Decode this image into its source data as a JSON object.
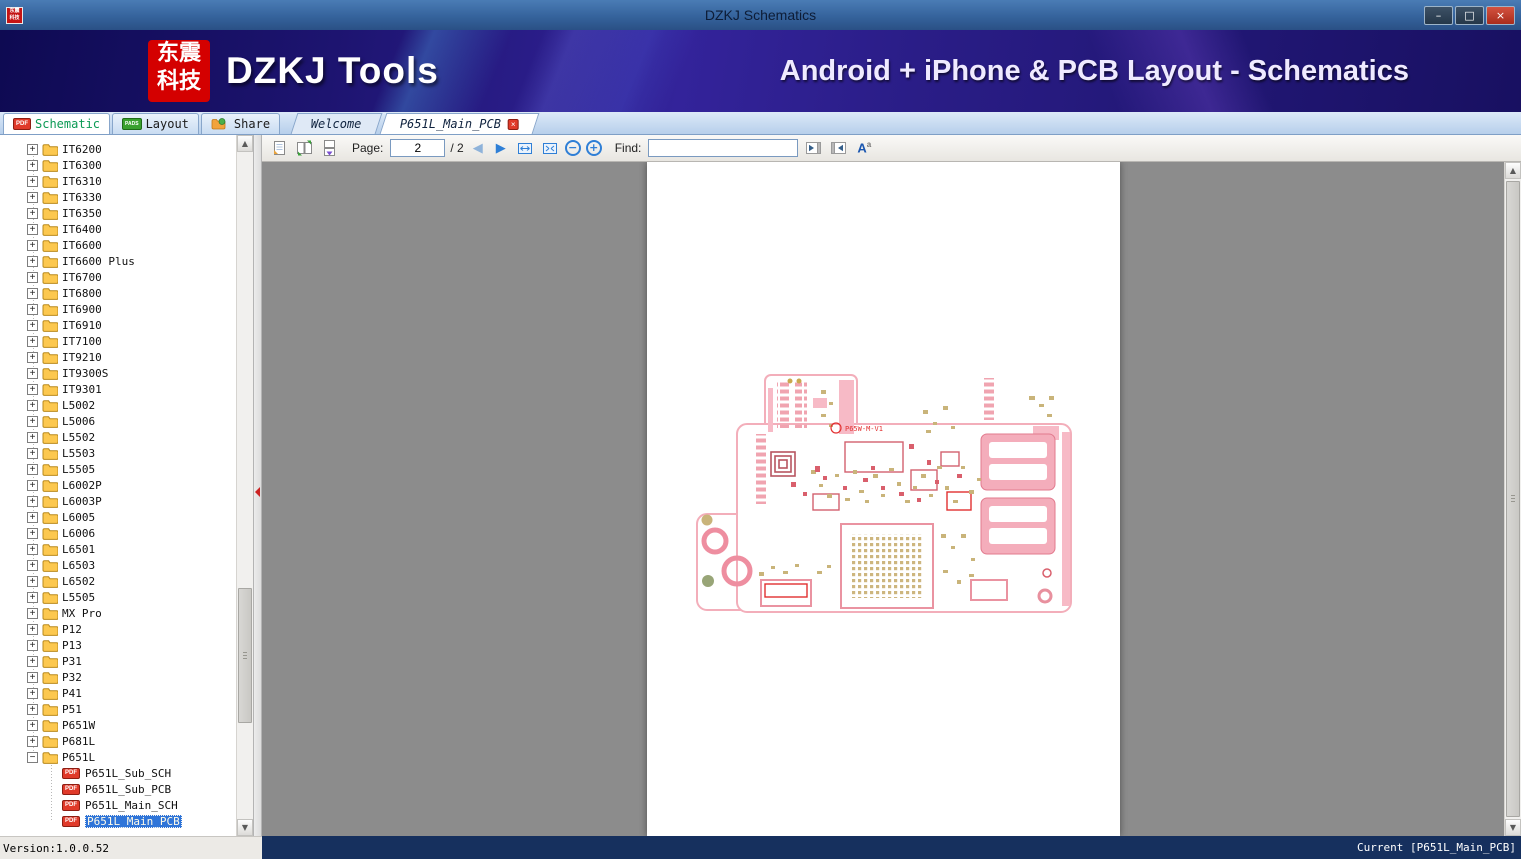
{
  "window": {
    "title": "DZKJ Schematics",
    "minimize_glyph": "–",
    "maximize_glyph": "□",
    "close_glyph": "×"
  },
  "logo": {
    "line1": "东震",
    "line2": "科技"
  },
  "banner": {
    "title": "DZKJ Tools",
    "subtitle": "Android + iPhone & PCB Layout - Schematics"
  },
  "main_tabs": [
    {
      "label": "Schematic",
      "badge": "PDF",
      "active": true
    },
    {
      "label": "Layout",
      "badge": "PADS",
      "active": false
    },
    {
      "label": "Share",
      "badge": "",
      "active": false
    }
  ],
  "doc_tabs": [
    {
      "label": "Welcome",
      "active": false,
      "closable": false
    },
    {
      "label": "P651L_Main_PCB",
      "active": true,
      "closable": true
    }
  ],
  "toolbar": {
    "page_label": "Page:",
    "page_value": "2",
    "page_total": "/ 2",
    "find_label": "Find:",
    "find_value": "",
    "prev_glyph": "◀",
    "next_glyph": "▶",
    "zoom_out_glyph": "−",
    "zoom_in_glyph": "+",
    "font_icon_main": "A",
    "font_icon_sup": "a"
  },
  "icons": {
    "scroll_up": "▲",
    "scroll_down": "▼",
    "tab_close": "×",
    "expand": "+",
    "collapse": "−"
  },
  "tree": {
    "file_badge": "PDF",
    "items": [
      {
        "label": "IT6200"
      },
      {
        "label": "IT6300"
      },
      {
        "label": "IT6310"
      },
      {
        "label": "IT6330"
      },
      {
        "label": "IT6350"
      },
      {
        "label": "IT6400"
      },
      {
        "label": "IT6600"
      },
      {
        "label": "IT6600 Plus"
      },
      {
        "label": "IT6700"
      },
      {
        "label": "IT6800"
      },
      {
        "label": "IT6900"
      },
      {
        "label": "IT6910"
      },
      {
        "label": "IT7100"
      },
      {
        "label": "IT9210"
      },
      {
        "label": "IT9300S"
      },
      {
        "label": "IT9301"
      },
      {
        "label": "L5002"
      },
      {
        "label": "L5006"
      },
      {
        "label": "L5502"
      },
      {
        "label": "L5503"
      },
      {
        "label": "L5505"
      },
      {
        "label": "L6002P"
      },
      {
        "label": "L6003P"
      },
      {
        "label": "L6005"
      },
      {
        "label": "L6006"
      },
      {
        "label": "L6501"
      },
      {
        "label": "L6503"
      },
      {
        "label": "L6502"
      },
      {
        "label": "L5505"
      },
      {
        "label": "MX Pro"
      },
      {
        "label": "P12"
      },
      {
        "label": "P13"
      },
      {
        "label": "P31"
      },
      {
        "label": "P32"
      },
      {
        "label": "P41"
      },
      {
        "label": "P51"
      },
      {
        "label": "P651W"
      },
      {
        "label": "P681L"
      },
      {
        "label": "P651L",
        "expanded": true,
        "children": [
          {
            "label": "P651L_Sub_SCH"
          },
          {
            "label": "P651L_Sub_PCB"
          },
          {
            "label": "P651L_Main_SCH"
          },
          {
            "label": "P651L_Main_PCB",
            "selected": true
          }
        ]
      }
    ]
  },
  "viewer": {
    "pcb_label": "P65W-M-V1"
  },
  "statusbar": {
    "version": "Version:1.0.0.52",
    "current": "Current [P651L_Main_PCB]"
  },
  "colors": {
    "accent_blue": "#2f7fd6",
    "selection_blue": "#2e74d8",
    "pdf_red": "#e03a2a",
    "pads_green": "#3aa12f",
    "banner_purple": "#2b1d86",
    "status_navy": "#16305e",
    "pcb_pink": "#f4adbb"
  }
}
